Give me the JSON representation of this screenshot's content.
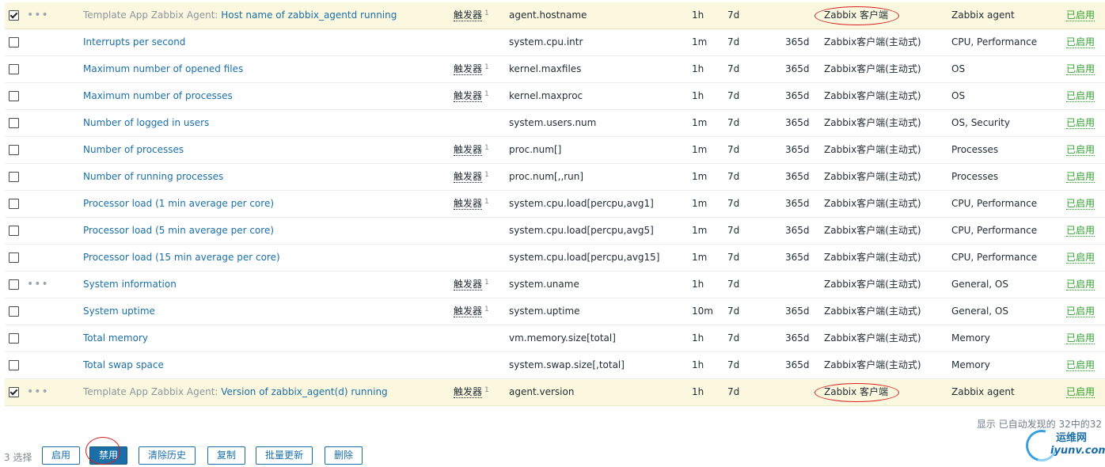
{
  "rows": [
    {
      "checked": true,
      "dots": true,
      "template": "Template App Zabbix Agent",
      "name": "Host name of zabbix_agentd running",
      "triggers_label": "触发器",
      "triggers_count": "1",
      "key": "agent.hostname",
      "interval": "1h",
      "history": "7d",
      "trends": "",
      "type": "Zabbix 客户端",
      "applications": "Zabbix agent",
      "status": "已启用",
      "highlight": true
    },
    {
      "checked": false,
      "dots": false,
      "template": "",
      "name": "Interrupts per second",
      "triggers_label": "",
      "triggers_count": "",
      "key": "system.cpu.intr",
      "interval": "1m",
      "history": "7d",
      "trends": "365d",
      "type": "Zabbix客户端(主动式)",
      "applications": "CPU, Performance",
      "status": "已启用",
      "highlight": false
    },
    {
      "checked": false,
      "dots": false,
      "template": "",
      "name": "Maximum number of opened files",
      "triggers_label": "触发器",
      "triggers_count": "1",
      "key": "kernel.maxfiles",
      "interval": "1h",
      "history": "7d",
      "trends": "365d",
      "type": "Zabbix客户端(主动式)",
      "applications": "OS",
      "status": "已启用",
      "highlight": false
    },
    {
      "checked": false,
      "dots": false,
      "template": "",
      "name": "Maximum number of processes",
      "triggers_label": "触发器",
      "triggers_count": "1",
      "key": "kernel.maxproc",
      "interval": "1h",
      "history": "7d",
      "trends": "365d",
      "type": "Zabbix客户端(主动式)",
      "applications": "OS",
      "status": "已启用",
      "highlight": false
    },
    {
      "checked": false,
      "dots": false,
      "template": "",
      "name": "Number of logged in users",
      "triggers_label": "",
      "triggers_count": "",
      "key": "system.users.num",
      "interval": "1m",
      "history": "7d",
      "trends": "365d",
      "type": "Zabbix客户端(主动式)",
      "applications": "OS, Security",
      "status": "已启用",
      "highlight": false
    },
    {
      "checked": false,
      "dots": false,
      "template": "",
      "name": "Number of processes",
      "triggers_label": "触发器",
      "triggers_count": "1",
      "key": "proc.num[]",
      "interval": "1m",
      "history": "7d",
      "trends": "365d",
      "type": "Zabbix客户端(主动式)",
      "applications": "Processes",
      "status": "已启用",
      "highlight": false
    },
    {
      "checked": false,
      "dots": false,
      "template": "",
      "name": "Number of running processes",
      "triggers_label": "触发器",
      "triggers_count": "1",
      "key": "proc.num[,,run]",
      "interval": "1m",
      "history": "7d",
      "trends": "365d",
      "type": "Zabbix客户端(主动式)",
      "applications": "Processes",
      "status": "已启用",
      "highlight": false
    },
    {
      "checked": false,
      "dots": false,
      "template": "",
      "name": "Processor load (1 min average per core)",
      "triggers_label": "触发器",
      "triggers_count": "1",
      "key": "system.cpu.load[percpu,avg1]",
      "interval": "1m",
      "history": "7d",
      "trends": "365d",
      "type": "Zabbix客户端(主动式)",
      "applications": "CPU, Performance",
      "status": "已启用",
      "highlight": false
    },
    {
      "checked": false,
      "dots": false,
      "template": "",
      "name": "Processor load (5 min average per core)",
      "triggers_label": "",
      "triggers_count": "",
      "key": "system.cpu.load[percpu,avg5]",
      "interval": "1m",
      "history": "7d",
      "trends": "365d",
      "type": "Zabbix客户端(主动式)",
      "applications": "CPU, Performance",
      "status": "已启用",
      "highlight": false
    },
    {
      "checked": false,
      "dots": false,
      "template": "",
      "name": "Processor load (15 min average per core)",
      "triggers_label": "",
      "triggers_count": "",
      "key": "system.cpu.load[percpu,avg15]",
      "interval": "1m",
      "history": "7d",
      "trends": "365d",
      "type": "Zabbix客户端(主动式)",
      "applications": "CPU, Performance",
      "status": "已启用",
      "highlight": false
    },
    {
      "checked": false,
      "dots": true,
      "template": "",
      "name": "System information",
      "triggers_label": "触发器",
      "triggers_count": "1",
      "key": "system.uname",
      "interval": "1h",
      "history": "7d",
      "trends": "",
      "type": "Zabbix客户端(主动式)",
      "applications": "General, OS",
      "status": "已启用",
      "highlight": false
    },
    {
      "checked": false,
      "dots": false,
      "template": "",
      "name": "System uptime",
      "triggers_label": "触发器",
      "triggers_count": "1",
      "key": "system.uptime",
      "interval": "10m",
      "history": "7d",
      "trends": "365d",
      "type": "Zabbix客户端(主动式)",
      "applications": "General, OS",
      "status": "已启用",
      "highlight": false
    },
    {
      "checked": false,
      "dots": false,
      "template": "",
      "name": "Total memory",
      "triggers_label": "",
      "triggers_count": "",
      "key": "vm.memory.size[total]",
      "interval": "1h",
      "history": "7d",
      "trends": "365d",
      "type": "Zabbix客户端(主动式)",
      "applications": "Memory",
      "status": "已启用",
      "highlight": false
    },
    {
      "checked": false,
      "dots": false,
      "template": "",
      "name": "Total swap space",
      "triggers_label": "",
      "triggers_count": "",
      "key": "system.swap.size[,total]",
      "interval": "1h",
      "history": "7d",
      "trends": "365d",
      "type": "Zabbix客户端(主动式)",
      "applications": "Memory",
      "status": "已启用",
      "highlight": false
    },
    {
      "checked": true,
      "dots": true,
      "template": "Template App Zabbix Agent",
      "name": "Version of zabbix_agent(d) running",
      "triggers_label": "触发器",
      "triggers_count": "1",
      "key": "agent.version",
      "interval": "1h",
      "history": "7d",
      "trends": "",
      "type": "Zabbix 客户端",
      "applications": "Zabbix agent",
      "status": "已启用",
      "highlight": true
    }
  ],
  "summary": "显示 已自动发现的 32中的32",
  "footer": {
    "selected": "3 选择",
    "buttons": [
      "启用",
      "禁用",
      "清除历史",
      "复制",
      "批量更新",
      "删除"
    ]
  },
  "watermark": {
    "cn": "运维网",
    "en": "iyunv.com"
  },
  "colors": {
    "link": "#1a6fa8",
    "status_enabled": "#2f9f2f",
    "selected_row": "#fcf8df",
    "annotation": "#d42020",
    "primary_button": "#1a6fa8"
  }
}
